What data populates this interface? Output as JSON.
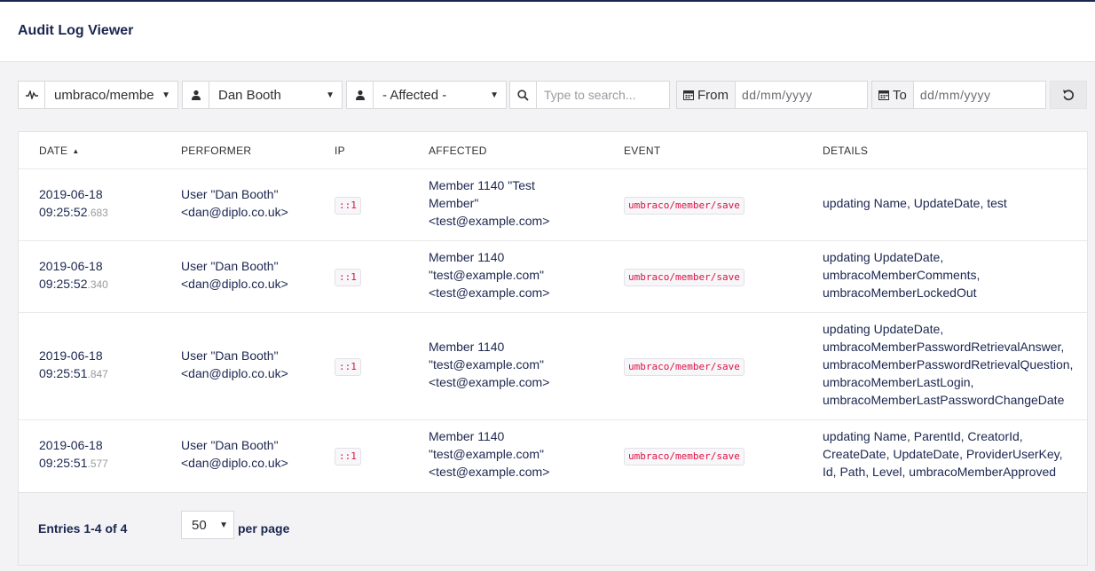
{
  "app": {
    "title": "Audit Log Viewer"
  },
  "filters": {
    "event": {
      "icon": "activity-icon",
      "value": "umbraco/membe"
    },
    "performer": {
      "icon": "user-icon",
      "value": "Dan Booth"
    },
    "affected": {
      "icon": "user-icon",
      "value": "- Affected -"
    },
    "search": {
      "icon": "search-icon",
      "placeholder": "Type to search..."
    },
    "from": {
      "icon": "calendar-icon",
      "label": "From",
      "value": "dd/mm/yyyy"
    },
    "to": {
      "icon": "calendar-icon",
      "label": "To",
      "value": "dd/mm/yyyy"
    },
    "reset": {
      "icon": "reset-icon"
    }
  },
  "table": {
    "headers": {
      "date": "DATE",
      "performer": "PERFORMER",
      "ip": "IP",
      "affected": "AFFECTED",
      "event": "EVENT",
      "details": "DETAILS"
    },
    "sort_indicator": "▲",
    "rows": [
      {
        "date": "2019-06-18",
        "time": "09:25:52",
        "ms": ".683",
        "performer_line1": "User \"Dan Booth\"",
        "performer_line2": "<dan@diplo.co.uk>",
        "ip": "::1",
        "affected_lines": [
          "Member 1140 \"Test",
          "Member\"",
          "<test@example.com>"
        ],
        "event": "umbraco/member/save",
        "details_lines": [
          "updating Name, UpdateDate, test"
        ]
      },
      {
        "date": "2019-06-18",
        "time": "09:25:52",
        "ms": ".340",
        "performer_line1": "User \"Dan Booth\"",
        "performer_line2": "<dan@diplo.co.uk>",
        "ip": "::1",
        "affected_lines": [
          "Member 1140",
          "\"test@example.com\"",
          "<test@example.com>"
        ],
        "event": "umbraco/member/save",
        "details_lines": [
          "updating UpdateDate,",
          "umbracoMemberComments,",
          "umbracoMemberLockedOut"
        ]
      },
      {
        "date": "2019-06-18",
        "time": "09:25:51",
        "ms": ".847",
        "performer_line1": "User \"Dan Booth\"",
        "performer_line2": "<dan@diplo.co.uk>",
        "ip": "::1",
        "affected_lines": [
          "Member 1140",
          "\"test@example.com\"",
          "<test@example.com>"
        ],
        "event": "umbraco/member/save",
        "details_lines": [
          "updating UpdateDate,",
          "umbracoMemberPasswordRetrievalAnswer,",
          "umbracoMemberPasswordRetrievalQuestion,",
          "umbracoMemberLastLogin,",
          "umbracoMemberLastPasswordChangeDate"
        ]
      },
      {
        "date": "2019-06-18",
        "time": "09:25:51",
        "ms": ".577",
        "performer_line1": "User \"Dan Booth\"",
        "performer_line2": "<dan@diplo.co.uk>",
        "ip": "::1",
        "affected_lines": [
          "Member 1140",
          "\"test@example.com\"",
          "<test@example.com>"
        ],
        "event": "umbraco/member/save",
        "details_lines": [
          "updating Name, ParentId, CreatorId,",
          "CreateDate, UpdateDate, ProviderUserKey,",
          "Id, Path, Level, umbracoMemberApproved"
        ]
      }
    ]
  },
  "footer": {
    "entries": "Entries 1-4 of 4",
    "page_size": "50",
    "per_page_label": "per page"
  }
}
